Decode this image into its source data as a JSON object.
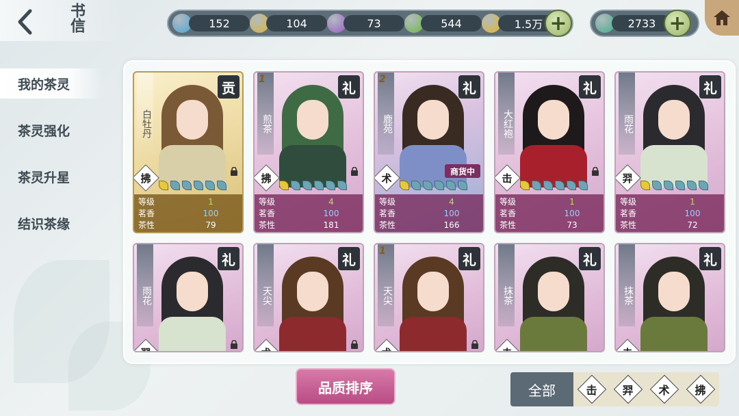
{
  "header": {
    "title": "书信",
    "resources": [
      {
        "icon": "blue-gem-icon",
        "value": "152",
        "color": "#4aa6d8"
      },
      {
        "icon": "gold-gem-icon",
        "value": "104",
        "color": "#d8b43a"
      },
      {
        "icon": "purple-gem-icon",
        "value": "73",
        "color": "#9a5ec8"
      },
      {
        "icon": "green-gem-icon",
        "value": "544",
        "color": "#6cba42"
      },
      {
        "icon": "gold-coin-icon",
        "value": "1.5万",
        "color": "#e0b62c"
      }
    ],
    "jade": {
      "icon": "jade-icon",
      "value": "2733",
      "color": "#3fae8c"
    }
  },
  "nav": {
    "items": [
      {
        "label": "我的茶灵",
        "active": true
      },
      {
        "label": "茶灵强化",
        "active": false
      },
      {
        "label": "茶灵升星",
        "active": false
      },
      {
        "label": "结识茶缘",
        "active": false
      }
    ]
  },
  "stats_labels": {
    "level": "等级",
    "aroma": "茗香",
    "nature": "茶性"
  },
  "cards": [
    {
      "name": "白牡丹",
      "badge": "贡",
      "rank": "",
      "suit": "拂",
      "tag": "",
      "style": "gold",
      "level": "1",
      "aroma": "100",
      "nature": "79",
      "hair": "#7a5a36",
      "outfit": "#d8cfa8",
      "locked": true
    },
    {
      "name": "煎茶",
      "badge": "礼",
      "rank": "1",
      "suit": "拂",
      "tag": "",
      "style": "pink",
      "level": "4",
      "aroma": "100",
      "nature": "181",
      "hair": "#3e6b44",
      "outfit": "#2f4c3c",
      "locked": true
    },
    {
      "name": "鹿苑",
      "badge": "礼",
      "rank": "2",
      "suit": "术",
      "tag": "商货中",
      "style": "blue",
      "level": "4",
      "aroma": "100",
      "nature": "166",
      "hair": "#3a2b22",
      "outfit": "#7d8fc6",
      "locked": false
    },
    {
      "name": "大红袍",
      "badge": "礼",
      "rank": "",
      "suit": "击",
      "tag": "",
      "style": "pink",
      "level": "1",
      "aroma": "100",
      "nature": "73",
      "hair": "#1e1a1c",
      "outfit": "#a8202b",
      "locked": true
    },
    {
      "name": "雨花",
      "badge": "礼",
      "rank": "",
      "suit": "羿",
      "tag": "",
      "style": "pink",
      "level": "1",
      "aroma": "100",
      "nature": "72",
      "hair": "#2b2a2e",
      "outfit": "#d8e3cf",
      "locked": false
    },
    {
      "name": "雨花",
      "badge": "礼",
      "rank": "",
      "suit": "羿",
      "tag": "",
      "style": "pink",
      "level": "",
      "aroma": "",
      "nature": "",
      "hair": "#2b2a2e",
      "outfit": "#d8e3cf",
      "locked": true
    },
    {
      "name": "天尖",
      "badge": "礼",
      "rank": "",
      "suit": "术",
      "tag": "",
      "style": "pink",
      "level": "",
      "aroma": "",
      "nature": "",
      "hair": "#5a3a22",
      "outfit": "#8d2a2e",
      "locked": true
    },
    {
      "name": "天尖",
      "badge": "礼",
      "rank": "1",
      "suit": "术",
      "tag": "",
      "style": "pink",
      "level": "",
      "aroma": "",
      "nature": "",
      "hair": "#5a3a22",
      "outfit": "#8d2a2e",
      "locked": true
    },
    {
      "name": "抹茶",
      "badge": "礼",
      "rank": "",
      "suit": "击",
      "tag": "",
      "style": "pink",
      "level": "",
      "aroma": "",
      "nature": "",
      "hair": "#2e2c26",
      "outfit": "#6a7a3c",
      "locked": false
    },
    {
      "name": "抹茶",
      "badge": "礼",
      "rank": "",
      "suit": "击",
      "tag": "",
      "style": "pink",
      "level": "",
      "aroma": "",
      "nature": "",
      "hair": "#2e2c26",
      "outfit": "#6a7a3c",
      "locked": false
    }
  ],
  "bottom": {
    "sort_label": "品质排序",
    "filter_all_label": "全部",
    "filter_suits": [
      "击",
      "羿",
      "术",
      "拂"
    ]
  }
}
